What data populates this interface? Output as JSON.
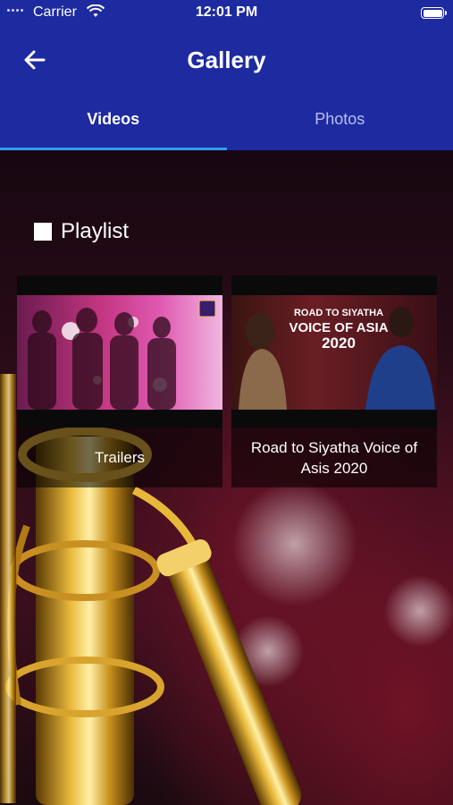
{
  "status_bar": {
    "carrier": "Carrier",
    "time": "12:01 PM"
  },
  "app_bar": {
    "title": "Gallery",
    "back_icon": "arrow-left-icon"
  },
  "tabs": [
    {
      "label": "Videos",
      "active": true
    },
    {
      "label": "Photos",
      "active": false
    }
  ],
  "colors": {
    "app_bar": "#1d2aa0",
    "tab_indicator": "#2f9dff"
  },
  "playlist": {
    "heading": "Playlist",
    "items": [
      {
        "caption": "Trailers"
      },
      {
        "caption": "Road to Siyatha Voice of Asis 2020",
        "thumb_text": {
          "line1": "ROAD TO SIYATHA",
          "line2": "VOICE OF ASIA",
          "line3": "2020"
        }
      }
    ]
  }
}
